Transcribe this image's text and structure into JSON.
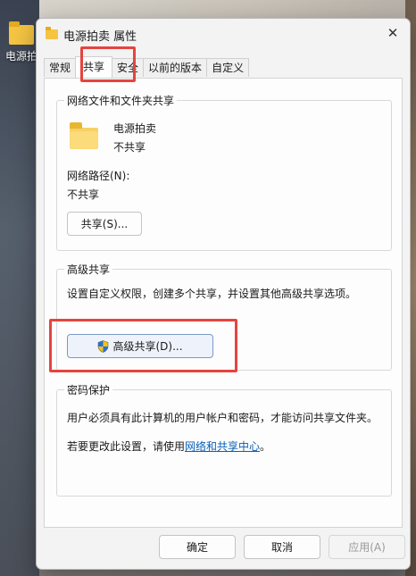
{
  "desktop": {
    "icon_label": "电源拍"
  },
  "dialog": {
    "title": "电源拍卖 属性",
    "close_glyph": "✕",
    "tabs": [
      "常规",
      "共享",
      "安全",
      "以前的版本",
      "自定义"
    ],
    "active_tab": "共享"
  },
  "network_sharing": {
    "group_title": "网络文件和文件夹共享",
    "folder_name": "电源拍卖",
    "share_status": "不共享",
    "path_label": "网络路径(N):",
    "path_value": "不共享",
    "share_button": "共享(S)..."
  },
  "advanced_sharing": {
    "group_title": "高级共享",
    "description": "设置自定义权限，创建多个共享，并设置其他高级共享选项。",
    "button_label": "高级共享(D)..."
  },
  "password_protection": {
    "group_title": "密码保护",
    "description": "用户必须具有此计算机的用户帐户和密码，才能访问共享文件夹。",
    "change_prefix": "若要更改此设置，请使用",
    "change_link": "网络和共享中心",
    "change_suffix": "。"
  },
  "footer": {
    "ok": "确定",
    "cancel": "取消",
    "apply": "应用(A)"
  },
  "icons": {
    "folder": "folder-icon",
    "shield": "uac-shield-icon",
    "close": "close-icon"
  },
  "colors": {
    "highlight_box": "#e5443f",
    "link": "#0a5fb4",
    "folder": "#f5c542"
  }
}
